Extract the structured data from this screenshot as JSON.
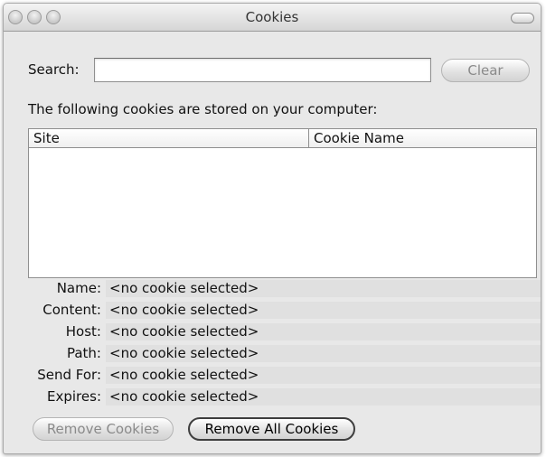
{
  "window": {
    "title": "Cookies"
  },
  "search": {
    "label": "Search:",
    "value": "",
    "placeholder": "",
    "clear_label": "Clear"
  },
  "intro_text": "The following cookies are stored on your computer:",
  "table": {
    "columns": [
      "Site",
      "Cookie Name"
    ],
    "rows": []
  },
  "details": [
    {
      "label": "Name:",
      "value": "<no cookie selected>"
    },
    {
      "label": "Content:",
      "value": "<no cookie selected>"
    },
    {
      "label": "Host:",
      "value": "<no cookie selected>"
    },
    {
      "label": "Path:",
      "value": "<no cookie selected>"
    },
    {
      "label": "Send For:",
      "value": "<no cookie selected>"
    },
    {
      "label": "Expires:",
      "value": "<no cookie selected>"
    }
  ],
  "actions": {
    "remove_label": "Remove Cookies",
    "remove_all_label": "Remove All Cookies"
  }
}
